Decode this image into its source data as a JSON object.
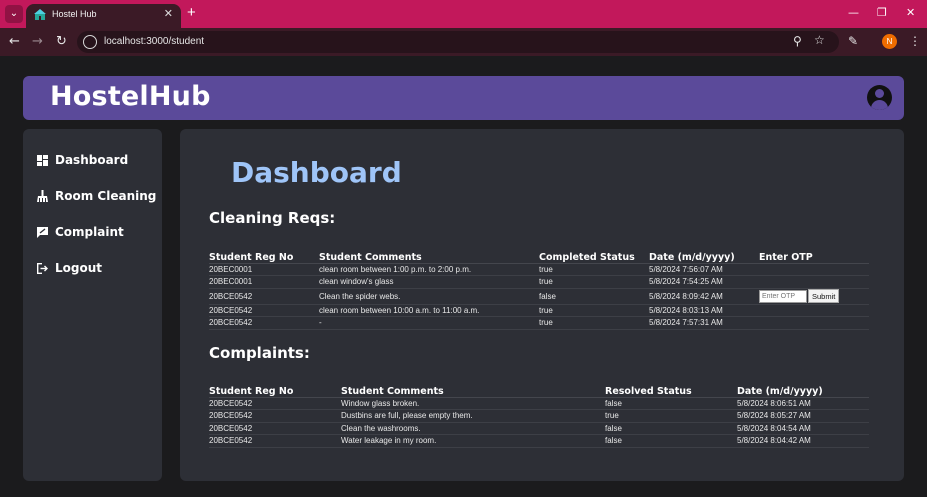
{
  "browser": {
    "tab_title": "Hostel Hub",
    "url": "localhost:3000/student",
    "profile_initial": "N"
  },
  "header": {
    "brand": "HostelHub"
  },
  "sidebar": {
    "items": [
      {
        "label": "Dashboard",
        "icon": "dashboard-icon"
      },
      {
        "label": "Room Cleaning",
        "icon": "broom-icon"
      },
      {
        "label": "Complaint",
        "icon": "complaint-icon"
      },
      {
        "label": "Logout",
        "icon": "logout-icon"
      }
    ]
  },
  "main": {
    "title": "Dashboard",
    "cleaning": {
      "title": "Cleaning Reqs:",
      "headers": [
        "Student Reg No",
        "Student Comments",
        "Completed Status",
        "Date (m/d/yyyy)",
        "Enter OTP"
      ],
      "rows": [
        [
          "20BEC0001",
          "clean room between 1:00 p.m. to 2:00 p.m.",
          "true",
          "5/8/2024 7:56:07 AM"
        ],
        [
          "20BEC0001",
          "clean window's glass",
          "true",
          "5/8/2024 7:54:25 AM"
        ],
        [
          "20BCE0542",
          "Clean the spider webs.",
          "false",
          "5/8/2024 8:09:42 AM"
        ],
        [
          "20BCE0542",
          "clean room between 10:00 a.m. to 11:00 a.m.",
          "true",
          "5/8/2024 8:03:13 AM"
        ],
        [
          "20BCE0542",
          "-",
          "true",
          "5/8/2024 7:57:31 AM"
        ]
      ],
      "otp_placeholder": "Enter OTP",
      "submit_label": "Submit"
    },
    "complaints": {
      "title": "Complaints:",
      "headers": [
        "Student Reg No",
        "Student Comments",
        "Resolved Status",
        "Date (m/d/yyyy)"
      ],
      "rows": [
        [
          "20BCE0542",
          "Window glass broken.",
          "false",
          "5/8/2024 8:06:51 AM"
        ],
        [
          "20BCE0542",
          "Dustbins are full, please empty them.",
          "true",
          "5/8/2024 8:05:27 AM"
        ],
        [
          "20BCE0542",
          "Clean the washrooms.",
          "false",
          "5/8/2024 8:04:54 AM"
        ],
        [
          "20BCE0542",
          "Water leakage in my room.",
          "false",
          "5/8/2024 8:04:42 AM"
        ]
      ]
    }
  },
  "colors": {
    "header_bg": "#5b4a9a",
    "title_accent": "#9fc5f8",
    "panel_bg": "#2d2f36",
    "browser_accent": "#c2185b"
  }
}
